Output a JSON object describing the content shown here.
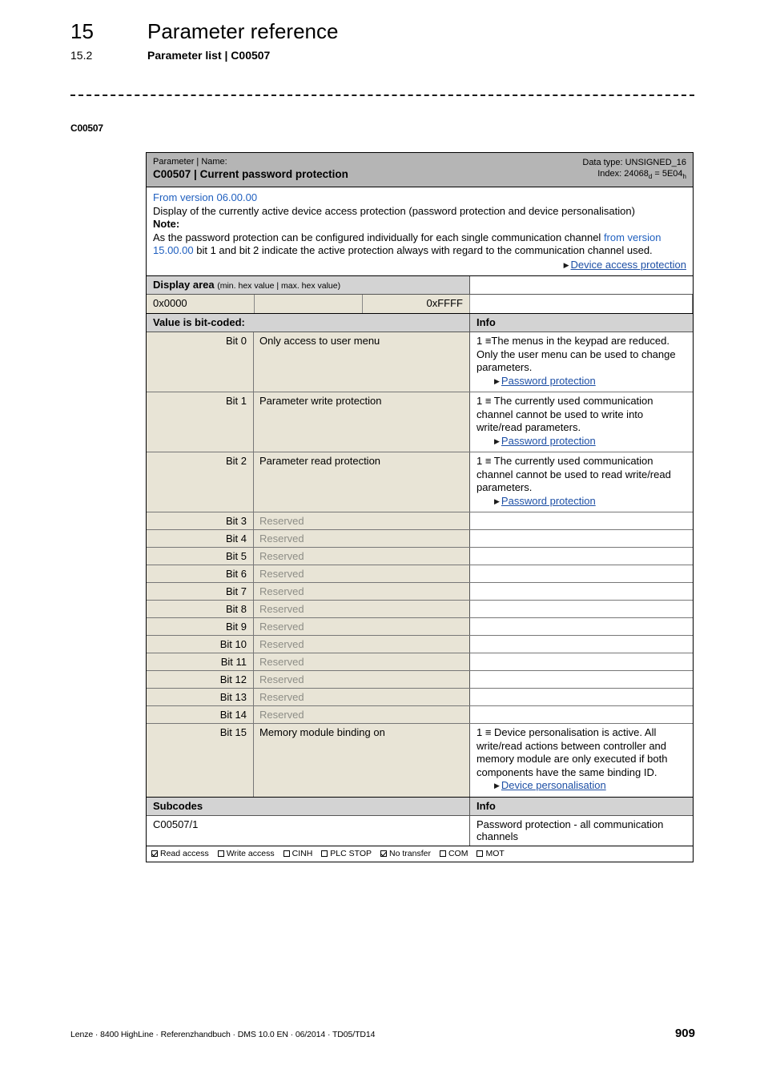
{
  "page": {
    "chapter_number": "15",
    "chapter_title": "Parameter reference",
    "section_number": "15.2",
    "section_title": "Parameter list | C00507",
    "margin_code": "C00507",
    "footer_text": "Lenze · 8400 HighLine · Referenzhandbuch · DMS 10.0 EN · 06/2014 · TD05/TD14",
    "page_number": "909"
  },
  "param": {
    "header_label": "Parameter | Name:",
    "header_name": "C00507 | Current password protection",
    "data_type": "Data type: UNSIGNED_16",
    "index_prefix": "Index: 24068",
    "index_sub1": "d",
    "index_mid": " = 5E04",
    "index_sub2": "h",
    "version_link": "From version 06.00.00",
    "description": "Display of the currently active device access protection (password protection and device personalisation)",
    "note_label": "Note:",
    "note_part1": "As the password protection can be configured individually for each single communication channel ",
    "note_link": "from version 15.00.00",
    "note_part2": " bit 1 and bit 2 indicate the active protection always with regard to the communication channel used.",
    "note_xref": "Device access protection"
  },
  "display_area": {
    "title": "Display area",
    "subtitle": "(min. hex value | max. hex value)",
    "min_value": "0x0000",
    "mid_value": "",
    "max_value": "0xFFFF"
  },
  "bit_table": {
    "header_left": "Value is bit-coded:",
    "header_right": "Info",
    "rows": [
      {
        "bit": "Bit 0",
        "name": "Only access to user menu",
        "info": "1 ≡The menus in the keypad are reduced. Only the user menu can be used to change parameters.",
        "xref": "Password protection",
        "reserved": false
      },
      {
        "bit": "Bit 1",
        "name": "Parameter write protection",
        "info": "1 ≡ The currently used communication channel cannot be used to write into write/read parameters.",
        "xref": "Password protection",
        "reserved": false
      },
      {
        "bit": "Bit 2",
        "name": "Parameter read protection",
        "info": "1 ≡ The currently used communication channel cannot be used to read write/read parameters.",
        "xref": "Password protection",
        "reserved": false
      },
      {
        "bit": "Bit 3",
        "name": "Reserved",
        "info": "",
        "xref": "",
        "reserved": true
      },
      {
        "bit": "Bit 4",
        "name": "Reserved",
        "info": "",
        "xref": "",
        "reserved": true
      },
      {
        "bit": "Bit 5",
        "name": "Reserved",
        "info": "",
        "xref": "",
        "reserved": true
      },
      {
        "bit": "Bit 6",
        "name": "Reserved",
        "info": "",
        "xref": "",
        "reserved": true
      },
      {
        "bit": "Bit 7",
        "name": "Reserved",
        "info": "",
        "xref": "",
        "reserved": true
      },
      {
        "bit": "Bit 8",
        "name": "Reserved",
        "info": "",
        "xref": "",
        "reserved": true
      },
      {
        "bit": "Bit 9",
        "name": "Reserved",
        "info": "",
        "xref": "",
        "reserved": true
      },
      {
        "bit": "Bit 10",
        "name": "Reserved",
        "info": "",
        "xref": "",
        "reserved": true
      },
      {
        "bit": "Bit 11",
        "name": "Reserved",
        "info": "",
        "xref": "",
        "reserved": true
      },
      {
        "bit": "Bit 12",
        "name": "Reserved",
        "info": "",
        "xref": "",
        "reserved": true
      },
      {
        "bit": "Bit 13",
        "name": "Reserved",
        "info": "",
        "xref": "",
        "reserved": true
      },
      {
        "bit": "Bit 14",
        "name": "Reserved",
        "info": "",
        "xref": "",
        "reserved": true
      },
      {
        "bit": "Bit 15",
        "name": "Memory module binding on",
        "info": "1 ≡ Device personalisation is active. All write/read actions between controller and memory module are only executed if both components have the same binding ID.",
        "xref": "Device personalisation",
        "reserved": false
      }
    ]
  },
  "subcodes": {
    "header_left": "Subcodes",
    "header_right": "Info",
    "rows": [
      {
        "code": "C00507/1",
        "info": "Password protection - all communication channels"
      }
    ]
  },
  "access_flags": [
    {
      "label": "Read access",
      "checked": true
    },
    {
      "label": "Write access",
      "checked": false
    },
    {
      "label": "CINH",
      "checked": false
    },
    {
      "label": "PLC STOP",
      "checked": false
    },
    {
      "label": "No transfer",
      "checked": true
    },
    {
      "label": "COM",
      "checked": false
    },
    {
      "label": "MOT",
      "checked": false
    }
  ],
  "colors": {
    "header_gray": "#b5b5b5",
    "subheader_gray": "#d3d3d3",
    "cell_beige": "#e8e4d6",
    "link_blue": "#1d4fa5",
    "version_blue": "#1f5fbf",
    "reserved_gray": "#8d8d86"
  }
}
